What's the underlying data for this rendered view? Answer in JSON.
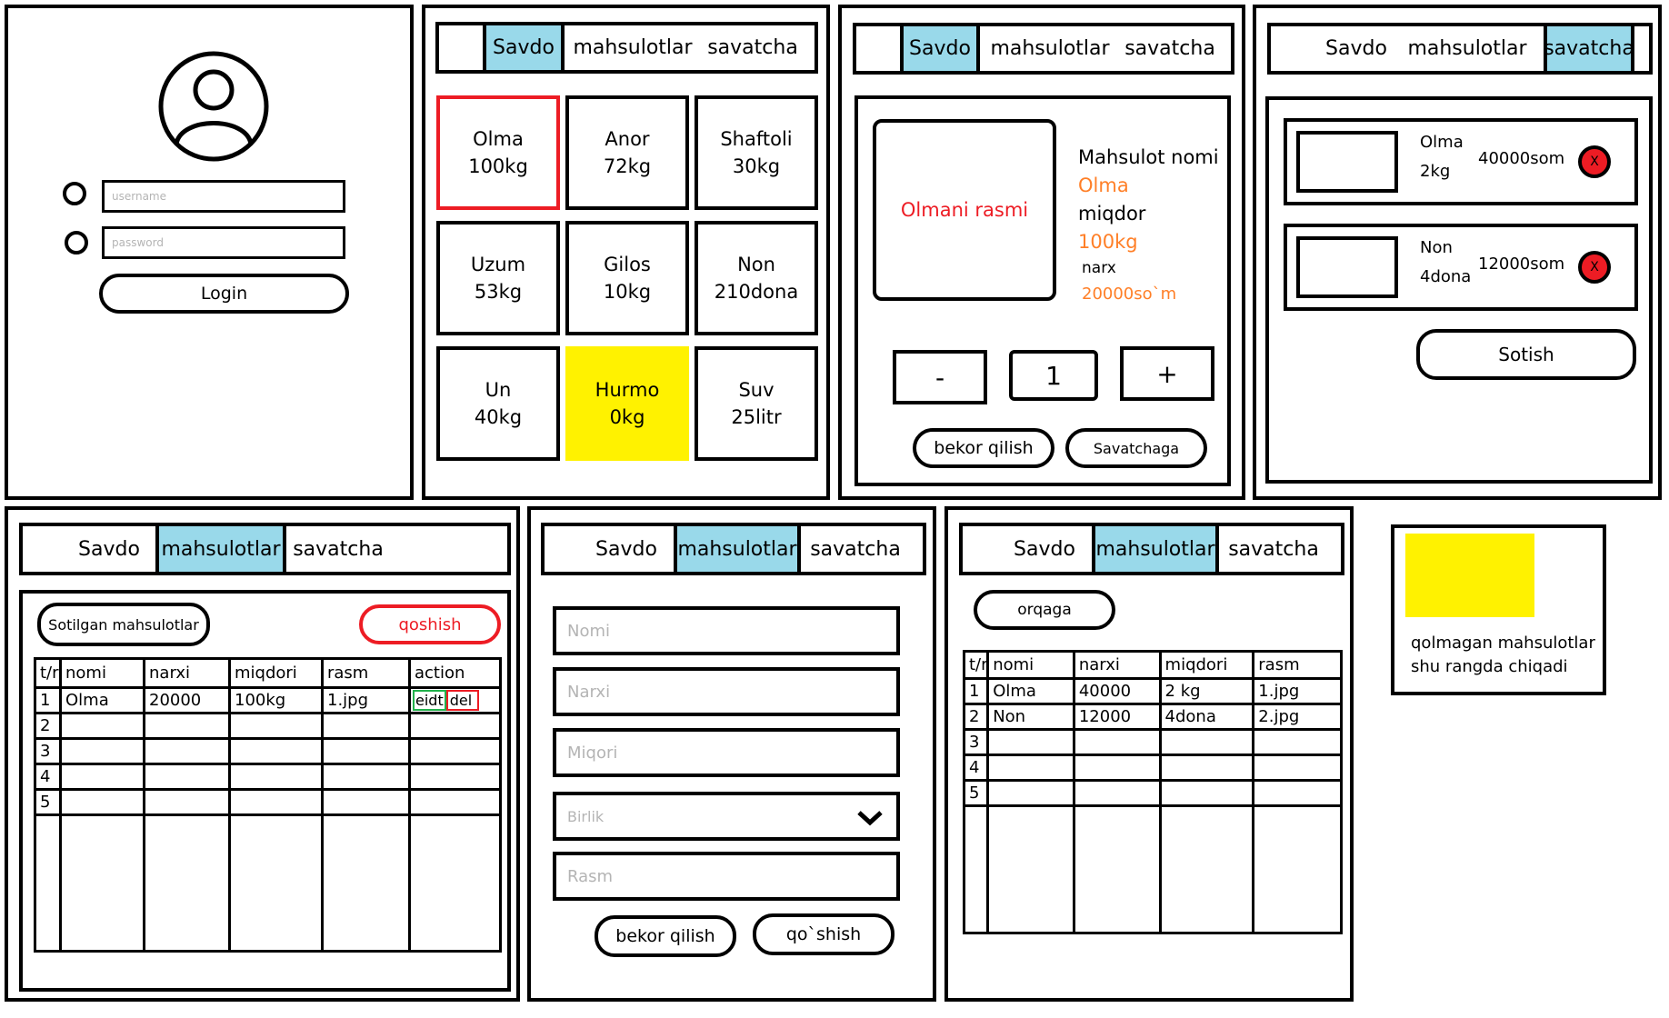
{
  "nav": {
    "savdo": "Savdo",
    "mahsulotlar": "mahsulotlar",
    "savatcha": "savatcha"
  },
  "login": {
    "username_placeholder": "username",
    "password_placeholder": "password",
    "login_button": "Login"
  },
  "savdo": {
    "products": [
      {
        "name": "Olma",
        "qty": "100kg"
      },
      {
        "name": "Anor",
        "qty": "72kg"
      },
      {
        "name": "Shaftoli",
        "qty": "30kg"
      },
      {
        "name": "Uzum",
        "qty": "53kg"
      },
      {
        "name": "Gilos",
        "qty": "10kg"
      },
      {
        "name": "Non",
        "qty": "210dona"
      },
      {
        "name": "Un",
        "qty": "40kg"
      },
      {
        "name": "Hurmo",
        "qty": "0kg"
      },
      {
        "name": "Suv",
        "qty": "25litr"
      }
    ]
  },
  "detail": {
    "image_label": "Olmani rasmi",
    "name_label": "Mahsulot nomi",
    "name_value": "Olma",
    "qty_label": "miqdor",
    "qty_value": "100kg",
    "price_label": "narx",
    "price_value": "20000so`m",
    "minus": "-",
    "count": "1",
    "plus": "+",
    "cancel": "bekor qilish",
    "to_cart": "Savatchaga"
  },
  "cart": {
    "items": [
      {
        "name": "Olma",
        "qty": "2kg",
        "price": "40000som",
        "remove": "X"
      },
      {
        "name": "Non",
        "qty": "4dona",
        "price": "12000som",
        "remove": "X"
      }
    ],
    "sell_button": "Sotish"
  },
  "products_admin": {
    "sold_button": "Sotilgan mahsulotlar",
    "add_button": "qoshish",
    "headers": [
      "t/r",
      "nomi",
      "narxi",
      "miqdori",
      "rasm",
      "action"
    ],
    "rows": [
      [
        "1",
        "Olma",
        "20000",
        "100kg",
        "1.jpg"
      ],
      [
        "2",
        "",
        "",
        "",
        ""
      ],
      [
        "3",
        "",
        "",
        "",
        ""
      ],
      [
        "4",
        "",
        "",
        "",
        ""
      ],
      [
        "5",
        "",
        "",
        "",
        ""
      ]
    ],
    "edit_label": "eidt",
    "del_label": "del"
  },
  "add_form": {
    "name_placeholder": "Nomi",
    "price_placeholder": "Narxi",
    "qty_placeholder": "Miqori",
    "unit_placeholder": "Birlik",
    "image_placeholder": "Rasm",
    "cancel": "bekor qilish",
    "add": "qo`shish"
  },
  "sold": {
    "back_button": "orqaga",
    "headers": [
      "t/r",
      "nomi",
      "narxi",
      "miqdori",
      "rasm"
    ],
    "rows": [
      [
        "1",
        "Olma",
        "40000",
        "2 kg",
        "1.jpg"
      ],
      [
        "2",
        "Non",
        "12000",
        "4dona",
        "2.jpg"
      ],
      [
        "3",
        "",
        "",
        "",
        ""
      ],
      [
        "4",
        "",
        "",
        "",
        ""
      ],
      [
        "5",
        "",
        "",
        "",
        ""
      ]
    ]
  },
  "legend": {
    "line1": "qolmagan mahsulotlar",
    "line2": "shu rangda chiqadi"
  },
  "colors": {
    "active_tab": "#99d9ea",
    "out_of_stock": "#fff200",
    "accent_red": "#ed1c24",
    "accent_orange": "#ff7f27"
  }
}
